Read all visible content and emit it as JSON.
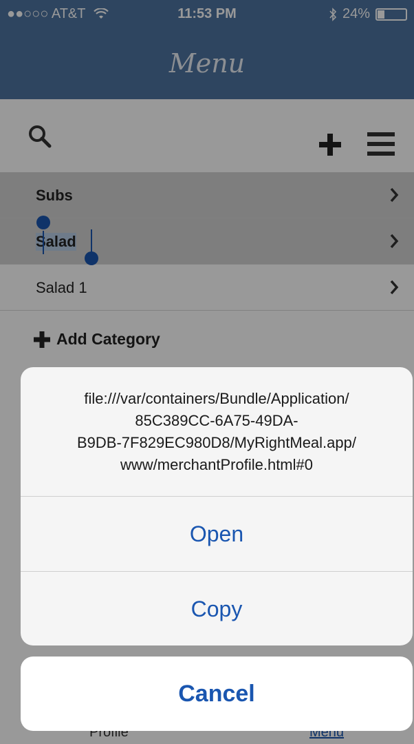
{
  "status_bar": {
    "carrier": "●●○○○ AT&T",
    "wifi_icon": "wifi-icon",
    "time": "11:53 PM",
    "bluetooth_icon": "bluetooth-icon",
    "battery": "24%",
    "battery_level": 0.24
  },
  "header": {
    "title": "Menu"
  },
  "toolbar": {
    "search_icon": "search-icon",
    "add_icon": "plus-icon",
    "menu_icon": "hamburger-icon"
  },
  "list": {
    "items": [
      {
        "label": "Subs"
      },
      {
        "label": "Salad"
      },
      {
        "label": "Salad 1"
      }
    ]
  },
  "add_category": {
    "label": "Add Category"
  },
  "action_sheet": {
    "message": "file:///var/containers/Bundle/Application/85C389CC-6A75-49DA-B9DB-7F829EC980D8/MyRightMeal.app/www/merchantProfile.html#0",
    "message_lines": [
      "file:///var/containers/Bundle/Application/",
      "85C389CC-6A75-49DA-",
      "B9DB-7F829EC980D8/MyRightMeal.app/",
      "www/merchantProfile.html#0"
    ],
    "open_label": "Open",
    "copy_label": "Copy",
    "cancel_label": "Cancel"
  },
  "tabbar": {
    "profile_label": "Profile",
    "menu_label": "Menu"
  },
  "colors": {
    "header_bg": "#4e73a0",
    "accent": "#1a56b0",
    "selection": "#b7cde6"
  }
}
